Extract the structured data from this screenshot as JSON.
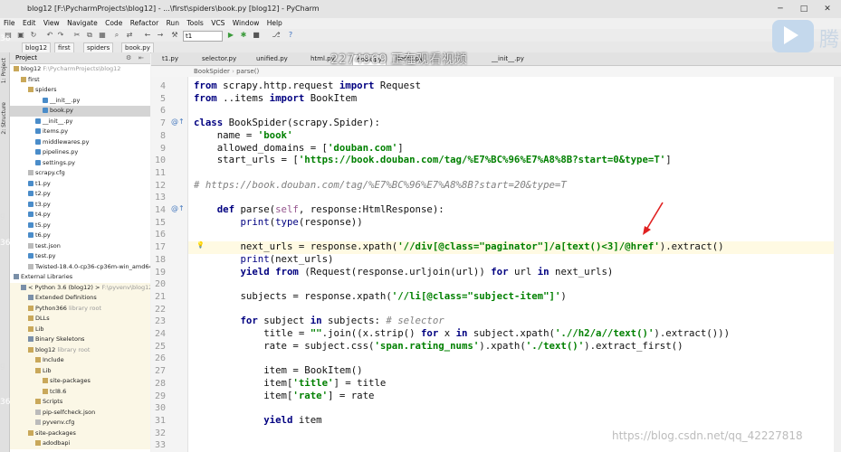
{
  "window": {
    "title": "blog12 [F:\\PycharmProjects\\blog12] - ...\\first\\spiders\\book.py [blog12] - PyCharm"
  },
  "menu": [
    "File",
    "Edit",
    "View",
    "Navigate",
    "Code",
    "Refactor",
    "Run",
    "Tools",
    "VCS",
    "Window",
    "Help"
  ],
  "toolbar": {
    "run_config": "t1"
  },
  "breadcrumbs": [
    "blog12",
    "first",
    "spiders",
    "book.py"
  ],
  "project_panel": {
    "header": "Project",
    "side_tabs": [
      "1: Project",
      "2: Structure"
    ],
    "tree": [
      {
        "label": "blog12",
        "extra": "F:\\PycharmProjects\\blog12",
        "indent": 0,
        "icon": "folder"
      },
      {
        "label": "first",
        "indent": 1,
        "icon": "folder"
      },
      {
        "label": "spiders",
        "indent": 2,
        "icon": "folder"
      },
      {
        "label": "__init__.py",
        "indent": 4,
        "icon": "py"
      },
      {
        "label": "book.py",
        "indent": 4,
        "icon": "py",
        "selected": true
      },
      {
        "label": "__init__.py",
        "indent": 3,
        "icon": "py"
      },
      {
        "label": "items.py",
        "indent": 3,
        "icon": "py"
      },
      {
        "label": "middlewares.py",
        "indent": 3,
        "icon": "py"
      },
      {
        "label": "pipelines.py",
        "indent": 3,
        "icon": "py"
      },
      {
        "label": "settings.py",
        "indent": 3,
        "icon": "py"
      },
      {
        "label": "scrapy.cfg",
        "indent": 2,
        "icon": "file"
      },
      {
        "label": "t1.py",
        "indent": 2,
        "icon": "py"
      },
      {
        "label": "t2.py",
        "indent": 2,
        "icon": "py"
      },
      {
        "label": "t3.py",
        "indent": 2,
        "icon": "py"
      },
      {
        "label": "t4.py",
        "indent": 2,
        "icon": "py"
      },
      {
        "label": "t5.py",
        "indent": 2,
        "icon": "py"
      },
      {
        "label": "t6.py",
        "indent": 2,
        "icon": "py"
      },
      {
        "label": "test.json",
        "indent": 2,
        "icon": "file"
      },
      {
        "label": "test.py",
        "indent": 2,
        "icon": "py"
      },
      {
        "label": "Twisted-18.4.0-cp36-cp36m-win_amd64.wh",
        "indent": 2,
        "icon": "file"
      },
      {
        "label": "External Libraries",
        "indent": 0,
        "icon": "lib"
      },
      {
        "label": "< Python 3.6 (blog12) >",
        "extra": "F:\\pyvenv\\blog12\\",
        "indent": 1,
        "icon": "lib",
        "lib": true
      },
      {
        "label": "Extended Definitions",
        "indent": 2,
        "icon": "lib",
        "lib": true
      },
      {
        "label": "Python366",
        "extra": "library root",
        "indent": 2,
        "icon": "folder",
        "lib": true
      },
      {
        "label": "DLLs",
        "indent": 2,
        "icon": "folder",
        "lib": true
      },
      {
        "label": "Lib",
        "indent": 2,
        "icon": "folder",
        "lib": true
      },
      {
        "label": "Binary Skeletons",
        "indent": 2,
        "icon": "lib",
        "lib": true
      },
      {
        "label": "blog12",
        "extra": "library root",
        "indent": 2,
        "icon": "folder",
        "lib": true
      },
      {
        "label": "Include",
        "indent": 3,
        "icon": "folder",
        "lib": true
      },
      {
        "label": "Lib",
        "indent": 3,
        "icon": "folder",
        "lib": true
      },
      {
        "label": "site-packages",
        "indent": 4,
        "icon": "folder",
        "lib": true
      },
      {
        "label": "tcl8.6",
        "indent": 4,
        "icon": "folder",
        "lib": true
      },
      {
        "label": "Scripts",
        "indent": 3,
        "icon": "folder",
        "lib": true
      },
      {
        "label": "pip-selfcheck.json",
        "indent": 3,
        "icon": "file",
        "lib": true
      },
      {
        "label": "pyvenv.cfg",
        "indent": 3,
        "icon": "file",
        "lib": true
      },
      {
        "label": "site-packages",
        "indent": 2,
        "icon": "folder",
        "lib": true
      },
      {
        "label": "adodbapi",
        "indent": 3,
        "icon": "folder",
        "lib": true
      }
    ]
  },
  "tabs": [
    "t1.py",
    "selector.py",
    "unified.py",
    "html.py",
    "book.py",
    "items.py",
    "__init__.py"
  ],
  "editor_crumbs": [
    "BookSpider",
    "parse()"
  ],
  "overlays": {
    "stream_watermark": "2274969 正在观看视频",
    "csdn_watermark": "https://blog.csdn.net/qq_42227818",
    "logo_text": "腾",
    "edge_numbers": [
      "36",
      "36",
      "36"
    ],
    "edge_chars": [
      "g",
      "g"
    ]
  },
  "code_lines": [
    {
      "n": "4",
      "text": "from scrapy.http.request import Request"
    },
    {
      "n": "5",
      "text": "from ..items import BookItem"
    },
    {
      "n": "6",
      "text": ""
    },
    {
      "n": "7",
      "text": "class BookSpider(scrapy.Spider):"
    },
    {
      "n": "8",
      "text": "    name = 'book'"
    },
    {
      "n": "9",
      "text": "    allowed_domains = ['douban.com']"
    },
    {
      "n": "10",
      "text": "    start_urls = ['https://book.douban.com/tag/%E7%BC%96%E7%A8%8B?start=0&type=T']"
    },
    {
      "n": "11",
      "text": ""
    },
    {
      "n": "12",
      "text": "# https://book.douban.com/tag/%E7%BC%96%E7%A8%8B?start=20&type=T"
    },
    {
      "n": "13",
      "text": ""
    },
    {
      "n": "14",
      "text": "    def parse(self, response:HtmlResponse):"
    },
    {
      "n": "15",
      "text": "        print(type(response))"
    },
    {
      "n": "16",
      "text": ""
    },
    {
      "n": "17",
      "text": "        next_urls = response.xpath('//div[@class=\"paginator\"]/a[text()<3]/@href').extract()"
    },
    {
      "n": "18",
      "text": "        print(next_urls)"
    },
    {
      "n": "19",
      "text": "        yield from (Request(response.urljoin(url)) for url in next_urls)"
    },
    {
      "n": "20",
      "text": ""
    },
    {
      "n": "21",
      "text": "        subjects = response.xpath('//li[@class=\"subject-item\"]')"
    },
    {
      "n": "22",
      "text": ""
    },
    {
      "n": "23",
      "text": "        for subject in subjects: # selector"
    },
    {
      "n": "24",
      "text": "            title = \"\".join((x.strip() for x in subject.xpath('.//h2/a//text()').extract()))"
    },
    {
      "n": "25",
      "text": "            rate = subject.css('span.rating_nums').xpath('./text()').extract_first()"
    },
    {
      "n": "26",
      "text": ""
    },
    {
      "n": "27",
      "text": "            item = BookItem()"
    },
    {
      "n": "28",
      "text": "            item['title'] = title"
    },
    {
      "n": "29",
      "text": "            item['rate'] = rate"
    },
    {
      "n": "30",
      "text": ""
    },
    {
      "n": "31",
      "text": "            yield item"
    },
    {
      "n": "32",
      "text": ""
    },
    {
      "n": "33",
      "text": ""
    }
  ]
}
